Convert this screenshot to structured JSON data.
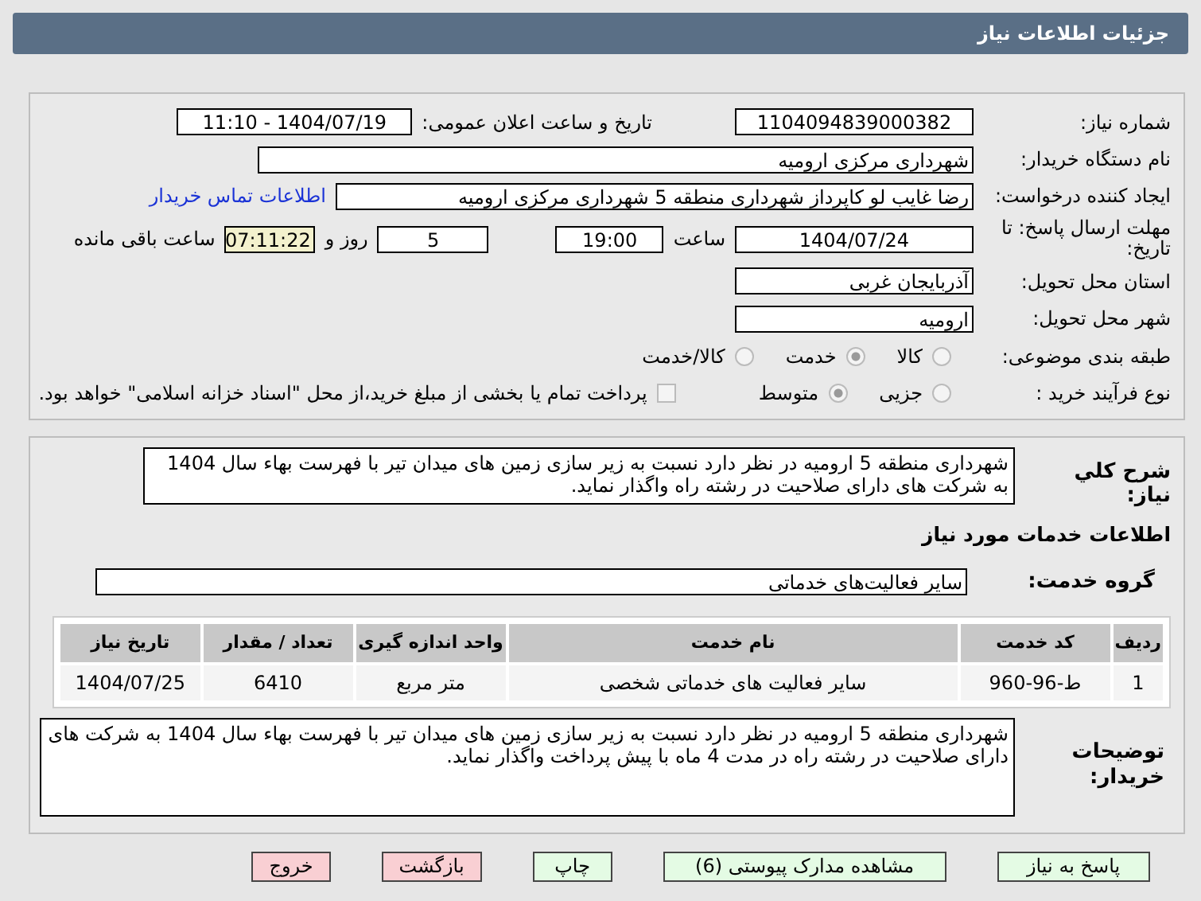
{
  "header": {
    "title": "جزئیات اطلاعات نیاز"
  },
  "fields": {
    "need_number": {
      "label": "شماره نیاز:",
      "value": "1104094839000382"
    },
    "announce": {
      "label": "تاریخ و ساعت اعلان عمومی:",
      "value": "1404/07/19 - 11:10"
    },
    "buyer_org": {
      "label": "نام دستگاه خریدار:",
      "value": "شهرداری مرکزی ارومیه"
    },
    "requester": {
      "label": "ایجاد کننده درخواست:",
      "value": "رضا غایب لو کاپرداز شهرداری منطقه 5 شهرداری مرکزی ارومیه",
      "link": "اطلاعات تماس خریدار"
    },
    "deadline": {
      "label": "مهلت ارسال پاسخ: تا تاریخ:",
      "date": "1404/07/24",
      "time_label": "ساعت",
      "time": "19:00",
      "days": "5",
      "days_label": "روز و",
      "remaining": "07:11:22",
      "remaining_label": "ساعت باقی مانده"
    },
    "province": {
      "label": "استان محل تحویل:",
      "value": "آذربایجان غربی"
    },
    "city": {
      "label": "شهر محل تحویل:",
      "value": "ارومیه"
    },
    "category": {
      "label": "طبقه بندی موضوعی:",
      "options": [
        {
          "label": "کالا",
          "selected": false
        },
        {
          "label": "خدمت",
          "selected": true
        },
        {
          "label": "کالا/خدمت",
          "selected": false
        }
      ]
    },
    "purchase": {
      "label": "نوع فرآیند خرید :",
      "options": [
        {
          "label": "جزیی",
          "selected": false
        },
        {
          "label": "متوسط",
          "selected": true
        }
      ],
      "payment": {
        "label": "پرداخت تمام یا بخشی از مبلغ خرید،از محل \"اسناد خزانه اسلامی\" خواهد بود.",
        "checked": false
      }
    }
  },
  "description": {
    "label": "شرح کلي نياز:",
    "value": "شهرداری منطقه 5 ارومیه در نظر دارد نسبت به زیر سازی زمین های میدان تیر با فهرست بهاء سال 1404 به شرکت های دارای صلاحیت در رشته راه  واگذار نماید."
  },
  "services": {
    "title": "اطلاعات خدمات مورد نیاز",
    "group_label": "گروه خدمت:",
    "group": "سایر فعالیت‌های خدماتی",
    "table": {
      "columns": [
        "ردیف",
        "کد خدمت",
        "نام خدمت",
        "واحد اندازه گیری",
        "تعداد / مقدار",
        "تاریخ نیاز"
      ],
      "rows": [
        [
          "1",
          "ط-96-960",
          "سایر فعالیت های خدماتی شخصی",
          "متر مربع",
          "6410",
          "1404/07/25"
        ]
      ]
    }
  },
  "buyer_notes": {
    "label": "توضیحات خریدار:",
    "value": "شهرداری منطقه 5 ارومیه در نظر دارد نسبت به زیر سازی زمین های میدان تیر با فهرست بهاء سال 1404 به شرکت های دارای صلاحیت در رشته راه در مدت 4 ماه با پیش پرداخت واگذار نماید."
  },
  "buttons": [
    {
      "label": "پاسخ به نیاز",
      "kind": "normal"
    },
    {
      "label": "مشاهده مدارک پیوستی (6)",
      "kind": "normal"
    },
    {
      "label": "چاپ",
      "kind": "normal"
    },
    {
      "label": "بازگشت",
      "kind": "danger"
    },
    {
      "label": "خروج",
      "kind": "danger"
    }
  ]
}
